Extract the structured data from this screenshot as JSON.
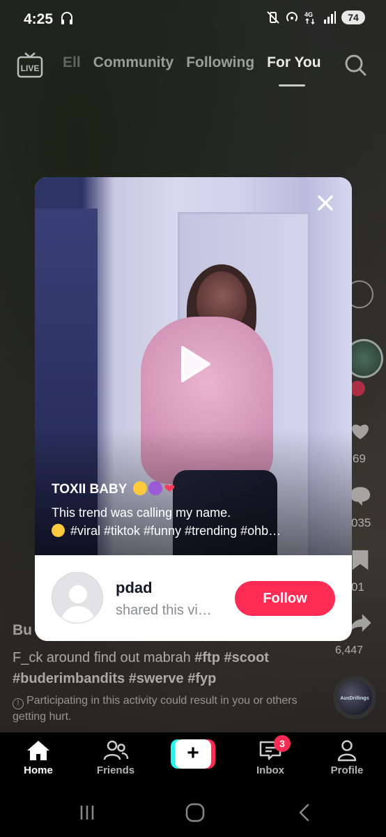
{
  "status_bar": {
    "time": "4:25",
    "battery": "74"
  },
  "top_nav": {
    "live_label": "LIVE",
    "tabs": [
      {
        "label": "Ell",
        "state": "faint"
      },
      {
        "label": "Community",
        "state": "inactive"
      },
      {
        "label": "Following",
        "state": "inactive"
      },
      {
        "label": "For You",
        "state": "active"
      }
    ]
  },
  "background_post": {
    "username": "Bu",
    "description_prefix": "F_ck around find out mabrah",
    "hashtags_line1": "#ftp #scoot",
    "hashtags_line2": "#buderimbandits #swerve #fyp",
    "warning": "Participating in this activity could result in you or others getting hurt.",
    "like_count": "69",
    "comment_count": "035",
    "bookmark_count": "01",
    "share_count": "6,447",
    "sound_label": "AusDrillings"
  },
  "shared_video": {
    "title": "TOXII BABY",
    "caption_line1": "This trend was calling my name.",
    "caption_line2": "#viral #tiktok #funny #trending #ohb…",
    "sharer_name": "pdad",
    "sharer_subtitle": "shared this vi…",
    "follow_label": "Follow"
  },
  "bottom_tabs": [
    {
      "label": "Home",
      "active": true
    },
    {
      "label": "Friends",
      "active": false
    },
    {
      "label": "Inbox",
      "active": false,
      "badge": "3"
    },
    {
      "label": "Profile",
      "active": false
    }
  ],
  "colors": {
    "accent": "#fe2c55",
    "create_cyan": "#25f4ee",
    "tab_bar_bg": "#000000"
  }
}
